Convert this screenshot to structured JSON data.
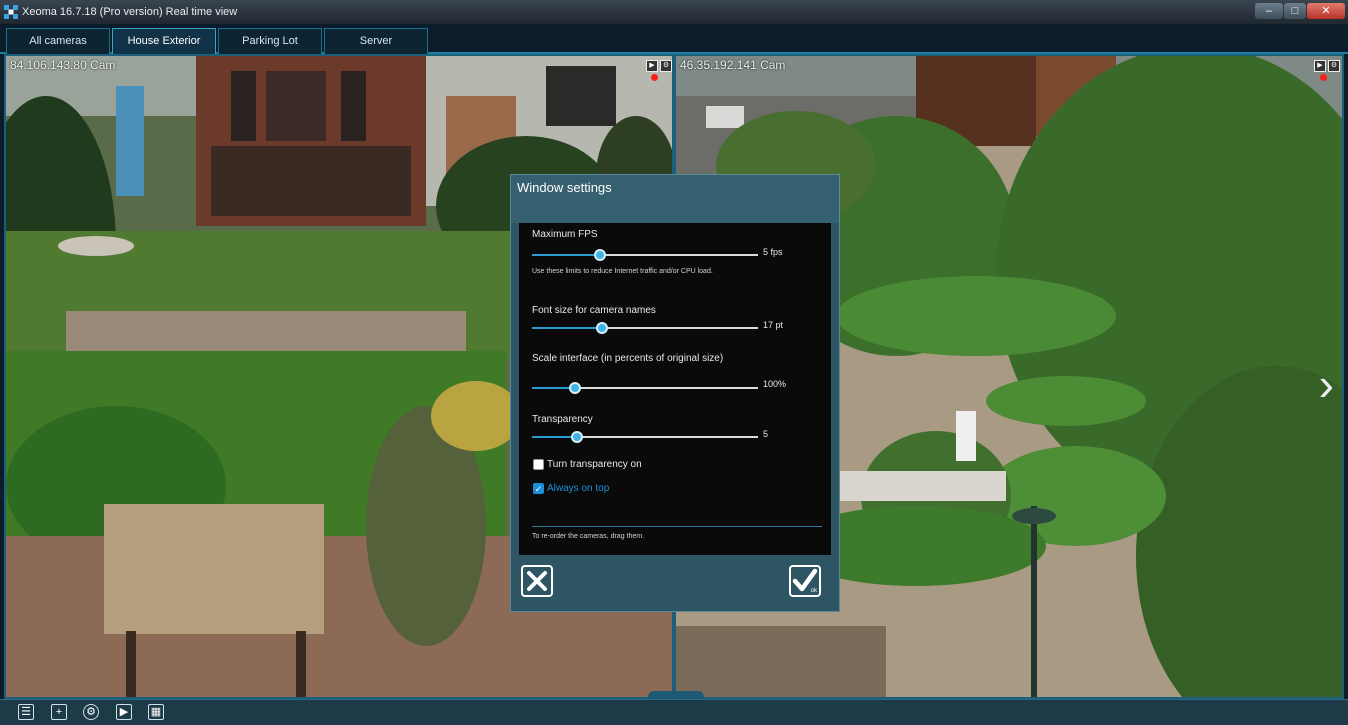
{
  "window": {
    "title": "Xeoma 16.7.18 (Pro version) Real time view"
  },
  "tabs": [
    {
      "label": "All cameras",
      "active": false
    },
    {
      "label": "House Exterior",
      "active": true
    },
    {
      "label": "Parking Lot",
      "active": false
    },
    {
      "label": "Server",
      "active": false
    }
  ],
  "cameras": {
    "left": {
      "name": "84.106.143.80 Cam"
    },
    "right": {
      "name": "46.35.192.141 Cam"
    }
  },
  "dialog": {
    "title": "Window settings",
    "max_fps": {
      "label": "Maximum FPS",
      "value_text": "5 fps",
      "level": 0.3
    },
    "hint": "Use these limits to reduce Internet traffic and/or CPU load.",
    "font_size": {
      "label": "Font size for camera names",
      "value_text": "17 pt",
      "level": 0.31
    },
    "scale": {
      "label": "Scale interface (in percents of original size)",
      "value_text": "100%",
      "level": 0.19
    },
    "transparency": {
      "label": "Transparency",
      "value_text": "5",
      "level": 0.2
    },
    "turn_transparency": {
      "label": "Turn transparency on",
      "checked": false
    },
    "always_on_top": {
      "label": "Always on top",
      "checked": true
    },
    "reorder_hint": "To re-order the cameras, drag them.",
    "ok_sub": "ok"
  },
  "colors": {
    "accent": "#2a9dd0",
    "dialog_bg": "#2e5564",
    "link_blue": "#1a8fd8"
  }
}
